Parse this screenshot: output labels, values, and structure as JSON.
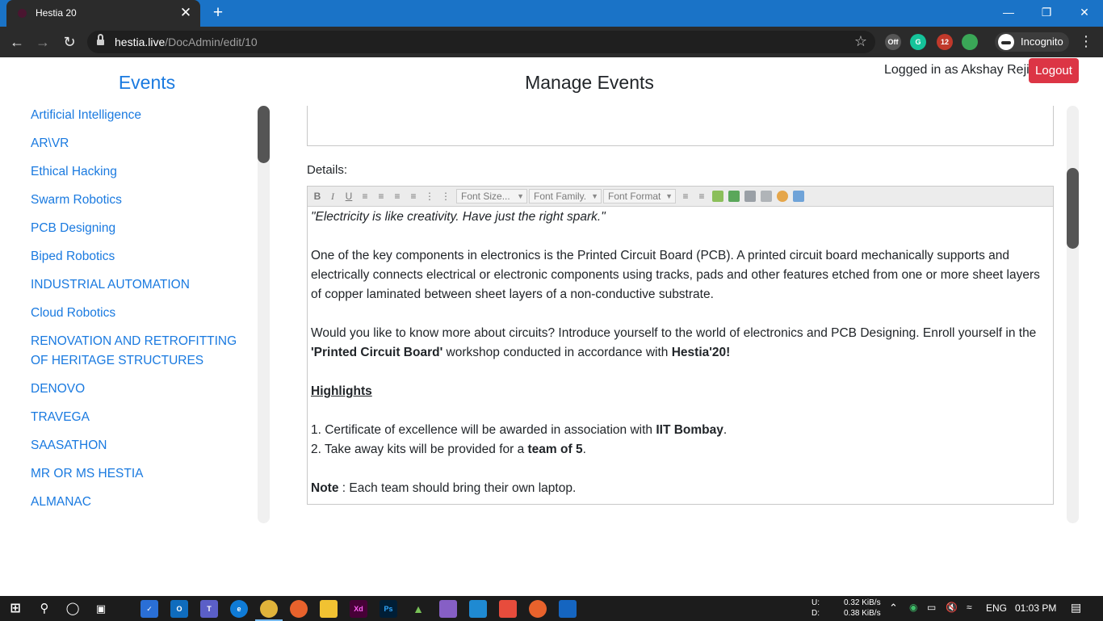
{
  "browser": {
    "tab_title": "Hestia 20",
    "tab_close": "✕",
    "new_tab": "+",
    "url_host": "hestia.live",
    "url_path": "/DocAdmin/edit/10",
    "profile_label": "Incognito",
    "extension_badges": {
      "off": "Off",
      "count": "12"
    }
  },
  "sidebar": {
    "title": "Events",
    "items": [
      "Artificial Intelligence",
      "AR\\VR",
      "Ethical Hacking",
      "Swarm Robotics",
      "PCB Designing",
      "Biped Robotics",
      "INDUSTRIAL AUTOMATION",
      "Cloud Robotics",
      "RENOVATION AND RETROFITTING OF HERITAGE STRUCTURES",
      "DENOVO",
      "TRAVEGA",
      "SAASATHON",
      "MR OR MS HESTIA",
      "ALMANAC"
    ]
  },
  "header": {
    "title": "Manage Events",
    "login_text": "Logged in as Akshay Reji",
    "logout_label": "Logout"
  },
  "form": {
    "details_label": "Details:",
    "toolbar": {
      "bold": "B",
      "italic": "I",
      "underline": "U",
      "font_size": "Font Size...",
      "font_family": "Font Family.",
      "font_format": "Font Format"
    },
    "content": {
      "quote": "\"Electricity is like creativity. Have just the right spark.\"",
      "para1": "One of the key components in electronics is the Printed Circuit Board (PCB). A printed circuit board mechanically supports and electrically connects electrical or electronic components using tracks, pads and other features etched from one or more sheet layers of copper laminated between sheet layers of a non-conductive substrate.",
      "para2_start": "Would you like to know more about circuits? Introduce yourself to the world of electronics and PCB Designing. Enroll yourself in the ",
      "para2_bold1": "'Printed Circuit Board'",
      "para2_mid": " workshop conducted in accordance with ",
      "para2_bold2": "Hestia'20!",
      "highlights": "Highlights",
      "hl1_start": "1. Certificate of excellence will be awarded in association with ",
      "hl1_bold": "IIT Bombay",
      "hl1_end": ".",
      "hl2_start": "2. Take away kits will be provided for a ",
      "hl2_bold": "team of 5",
      "hl2_end": ".",
      "note_bold": "Note",
      "note_text": " : Each team should bring their own laptop."
    }
  },
  "taskbar": {
    "net_up_label": "U:",
    "net_down_label": "D:",
    "net_up": "0.32 KiB/s",
    "net_down": "0.38 KiB/s",
    "language": "ENG",
    "time": "01:03 PM"
  },
  "colors": {
    "accent_blue": "#1a7ae0",
    "logout_red": "#dc3545",
    "chrome_dark": "#2b2b2b",
    "titlebar_blue": "#1a73c7"
  }
}
